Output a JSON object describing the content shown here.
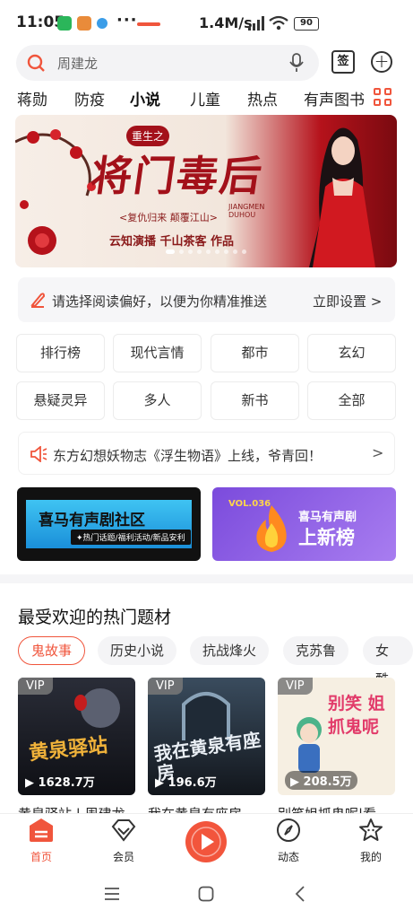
{
  "status": {
    "time": "11:05",
    "dots": "···",
    "network": "1.4M/s",
    "battery": "90"
  },
  "search": {
    "placeholder": "周建龙",
    "sign_label": "签"
  },
  "tabs": [
    "蒋勋",
    "防疫",
    "小说",
    "儿童",
    "热点",
    "有声图书"
  ],
  "active_tab": 2,
  "banner": {
    "badge": "重生之",
    "title": "将门毒后",
    "subtitle": "<复仇归来 颠覆江山>",
    "credit": "云知演播  千山茶客 作品",
    "english": "JIANGMEN DUHOU"
  },
  "preference": {
    "text": "请选择阅读偏好，以便为你精准推送",
    "action": "立即设置 >"
  },
  "categories": [
    "排行榜",
    "现代言情",
    "都市",
    "玄幻",
    "悬疑灵异",
    "多人",
    "新书",
    "全部"
  ],
  "notice": {
    "text": "东方幻想妖物志《浮生物语》上线，爷青回！",
    "arrow": ">"
  },
  "promo": [
    {
      "title": "喜马有声剧社区",
      "sub": "✦热门话题/福利活动/新品安利"
    },
    {
      "vol": "VOL.036",
      "line1": "喜马有声剧",
      "line2": "上新榜"
    }
  ],
  "section": {
    "title": "最受欢迎的热门题材",
    "chips": [
      "鬼故事",
      "历史小说",
      "抗战烽火",
      "克苏鲁",
      "女酷"
    ],
    "cards": [
      {
        "badge": "VIP",
        "art": "黄泉驿站",
        "plays": "1628.7万",
        "title": "黄泉驿站 | 周建龙"
      },
      {
        "badge": "VIP",
        "art": "我在黄泉有座房",
        "plays": "196.6万",
        "title": "我在黄泉有座房"
      },
      {
        "badge": "VIP",
        "art": "别笑 姐抓鬼呢",
        "plays": "208.5万",
        "title": "别笑姐抓鬼呢|看"
      }
    ]
  },
  "bottom_nav": [
    "首页",
    "会员",
    "",
    "动态",
    "我的"
  ],
  "colors": {
    "accent": "#f0553c"
  }
}
